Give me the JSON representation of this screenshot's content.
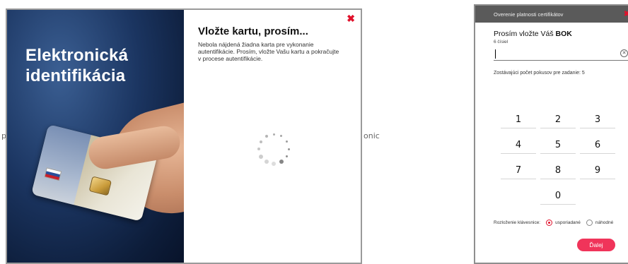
{
  "background": {
    "fragment_left": "p",
    "fragment_right": "onic"
  },
  "auth_dialog": {
    "promo_title_line1": "Elektronická",
    "promo_title_line2": "identifikácia",
    "close_icon": "close-icon",
    "heading": "Vložte kartu, prosím...",
    "message": "Nebola nájdená žiadna karta pre vykonanie autentifikácie. Prosím, vložte Vašu kartu a pokračujte v procese autentifikácie.",
    "spinner_icon": "loading-spinner-icon"
  },
  "pin_dialog": {
    "title": "Overenie platnosti certifikátov",
    "close_icon": "close-icon",
    "prompt_prefix": "Prosím vložte Váš ",
    "prompt_code": "BOK",
    "hint": "6 čísiel",
    "pin_value": "",
    "clear_icon": "clear-icon",
    "attempts_text": "Zostávajúci počet pokusov pre zadanie: 5",
    "keys": [
      "1",
      "2",
      "3",
      "4",
      "5",
      "6",
      "7",
      "8",
      "9",
      "0"
    ],
    "layout_label": "Rozloženie klávesnice:",
    "layout_options": [
      "usporiadané",
      "náhodné"
    ],
    "layout_selected": "usporiadané",
    "next_button": "Ďalej",
    "accent_color": "#e0112b"
  }
}
